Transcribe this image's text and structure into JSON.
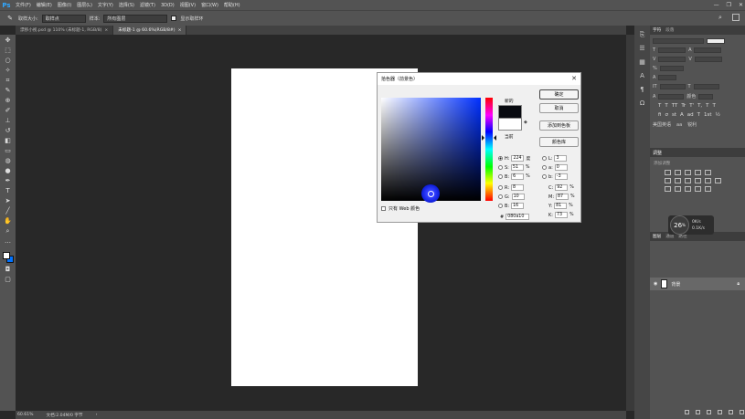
{
  "app": {
    "logo": "Ps",
    "menu": [
      "文件(F)",
      "编辑(E)",
      "图像(I)",
      "图层(L)",
      "文字(Y)",
      "选择(S)",
      "滤镜(T)",
      "3D(D)",
      "视图(V)",
      "窗口(W)",
      "帮助(H)"
    ],
    "window_controls": [
      "—",
      "❐",
      "✕"
    ]
  },
  "options": {
    "sample_size_label": "取样大小:",
    "sample_size_value": "取样点",
    "sample_label": "样本:",
    "sample_value": "所有图层",
    "show_ring_label": "显示取样环"
  },
  "tabs": [
    {
      "label": "漂移小视.psd @ 110% (未标题-1, RGB/8)",
      "close": "×"
    },
    {
      "label": "未标题-1 @ 60.6%(RGB/8#)",
      "close": "×"
    }
  ],
  "status": {
    "zoom": "60.61%",
    "doc_info": "文档:2.04M/0 字节"
  },
  "panels": {
    "character_tab": "字符",
    "paragraph_tab": "段落",
    "adjust_tab": "调整",
    "adjust_subtitle": "添加调整",
    "layers_tab": "图层",
    "channels_tab": "通道",
    "paths_tab": "路径",
    "layer_name": "背景",
    "typo_row1": [
      "T",
      "T",
      "TT",
      "Tr",
      "T'",
      "T,",
      "T",
      "T"
    ],
    "typo_row2": [
      "fi",
      "σ",
      "st",
      "A",
      "ad",
      "T",
      "1st",
      "½"
    ],
    "lang": "美国英语",
    "aa": "aa",
    "aa_value": "锐利"
  },
  "perf": {
    "percent": "26",
    "unit": "%",
    "up": "0K/s",
    "down": "0.1K/s"
  },
  "dialog": {
    "title": "拾色器（前景色）",
    "close": "✕",
    "new_label": "新的",
    "current_label": "当前",
    "buttons": {
      "ok": "确定",
      "cancel": "取消",
      "add_swatch": "添加到色板",
      "libraries": "颜色库"
    },
    "web_only": "只有 Web 颜色",
    "hsb": [
      {
        "label": "H:",
        "value": "224",
        "unit": "度"
      },
      {
        "label": "S:",
        "value": "51",
        "unit": "%"
      },
      {
        "label": "B:",
        "value": "6",
        "unit": "%"
      }
    ],
    "rgb": [
      {
        "label": "R:",
        "value": "8"
      },
      {
        "label": "G:",
        "value": "10"
      },
      {
        "label": "B:",
        "value": "16"
      }
    ],
    "lab": [
      {
        "label": "L:",
        "value": "3"
      },
      {
        "label": "a:",
        "value": "0"
      },
      {
        "label": "b:",
        "value": "-3"
      }
    ],
    "cmyk": [
      {
        "label": "C:",
        "value": "92",
        "unit": "%"
      },
      {
        "label": "M:",
        "value": "87",
        "unit": "%"
      },
      {
        "label": "Y:",
        "value": "81",
        "unit": "%"
      },
      {
        "label": "K:",
        "value": "73",
        "unit": "%"
      }
    ],
    "hex_label": "#",
    "hex_value": "080a10",
    "new_color": "#080a10",
    "current_color": "#ffffff"
  }
}
